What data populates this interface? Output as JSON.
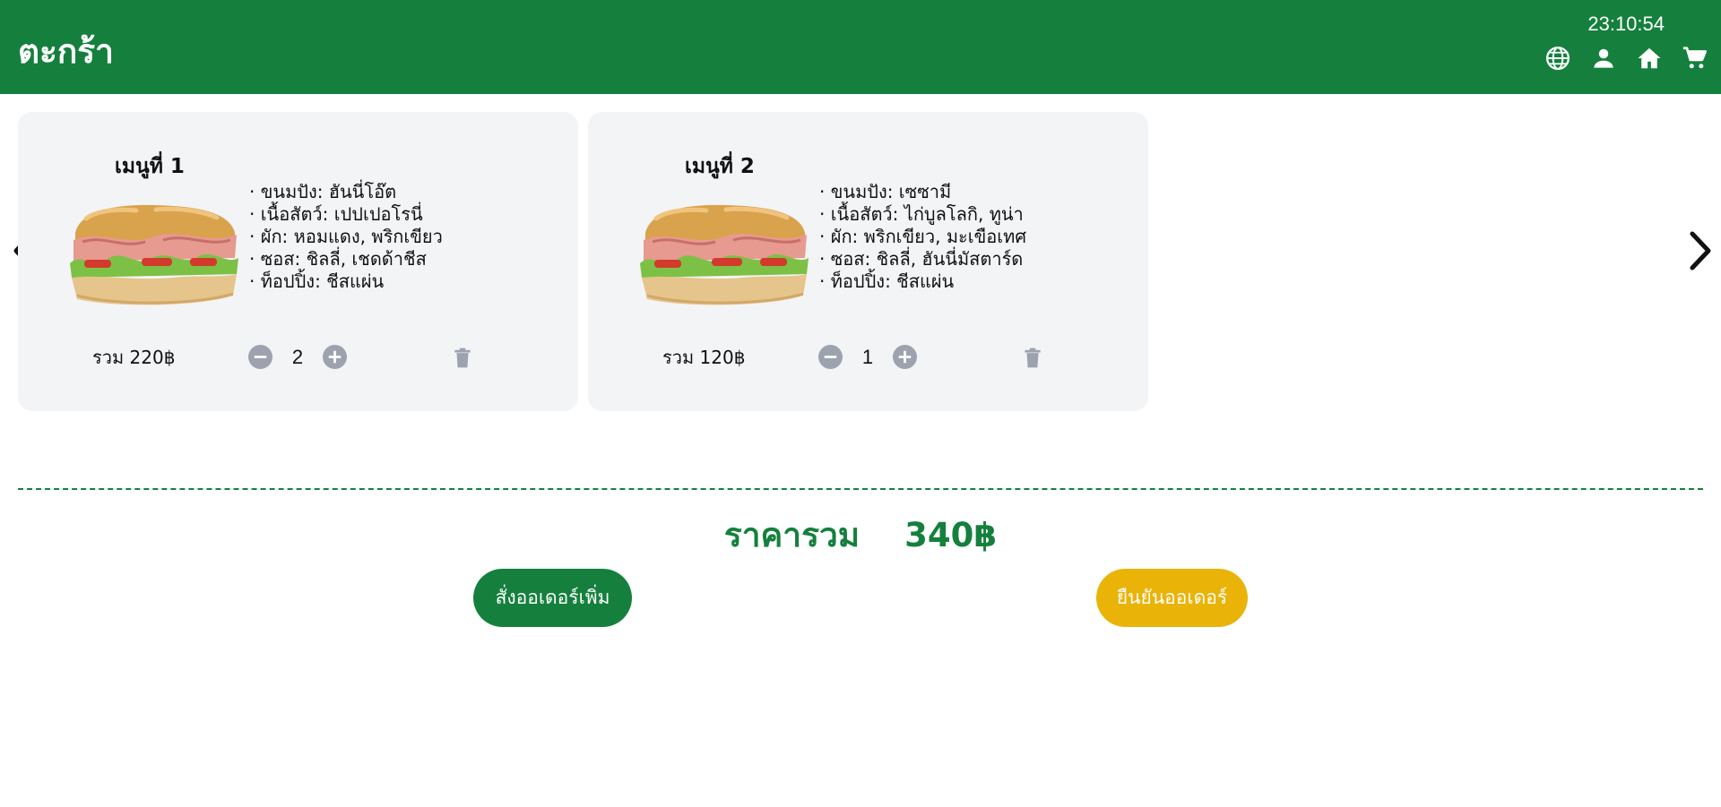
{
  "header": {
    "title": "ตะกร้า",
    "clock": "23:10:54",
    "icons": [
      "globe-icon",
      "user-icon",
      "home-icon",
      "cart-icon"
    ]
  },
  "cart": {
    "items": [
      {
        "title": "เมนูที่ 1",
        "details": [
          "ขนมปัง: ฮันนี่โอ๊ต",
          "เนื้อสัตว์: เปปเปอโรนี่",
          "ผัก: หอมแดง, พริกเขียว",
          "ซอส: ชิลลี่, เชดด้าชีส",
          "ท็อปปิ้ง: ชีสแผ่น"
        ],
        "total": "รวม 220฿",
        "quantity": "2"
      },
      {
        "title": "เมนูที่ 2",
        "details": [
          "ขนมปัง: เซซามี",
          "เนื้อสัตว์: ไก่บูลโลกิ, ทูน่า",
          "ผัก: พริกเขียว, มะเขือเทศ",
          "ซอส: ชิลลี่, ฮันนี่มัสตาร์ด",
          "ท็อปปิ้ง: ชีสแผ่น"
        ],
        "total": "รวม 120฿",
        "quantity": "1"
      }
    ]
  },
  "summary": {
    "label": "ราคารวม",
    "amount": "340฿"
  },
  "actions": {
    "order_more": "สั่งออเดอร์เพิ่ม",
    "confirm": "ยืนยันออเดอร์"
  },
  "colors": {
    "brand_green": "#15803d",
    "confirm_yellow": "#eab308",
    "card_bg": "#f3f4f6",
    "control_gray": "#9ca3af"
  }
}
